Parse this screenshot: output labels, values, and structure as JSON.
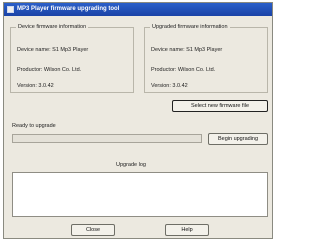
{
  "window": {
    "title": "MP3 Player firmware upgrading tool"
  },
  "device_firmware": {
    "legend": "Device firmware information",
    "device_name": "Device name: S1 Mp3 Player",
    "productor": "Productor: Wilson Co. Ltd.",
    "version": "Version: 3.0.42"
  },
  "upgraded_firmware": {
    "legend": "Upgraded firmware information",
    "device_name": "Device name: S1 Mp3 Player",
    "productor": "Productor: Wilson Co. Ltd.",
    "version": "Version: 3.0.42"
  },
  "buttons": {
    "select_firmware": "Select new firmware file",
    "begin_upgrading": "Begin upgrading",
    "close": "Close",
    "help": "Help"
  },
  "status": {
    "ready_text": "Ready to upgrade",
    "progress_fraction": 0
  },
  "log": {
    "label": "Upgrade log",
    "content": ""
  },
  "colors": {
    "titlebar": "#1f4fb8",
    "dialog_bg": "#ece9e0"
  },
  "icons": {
    "app": "app-icon"
  }
}
